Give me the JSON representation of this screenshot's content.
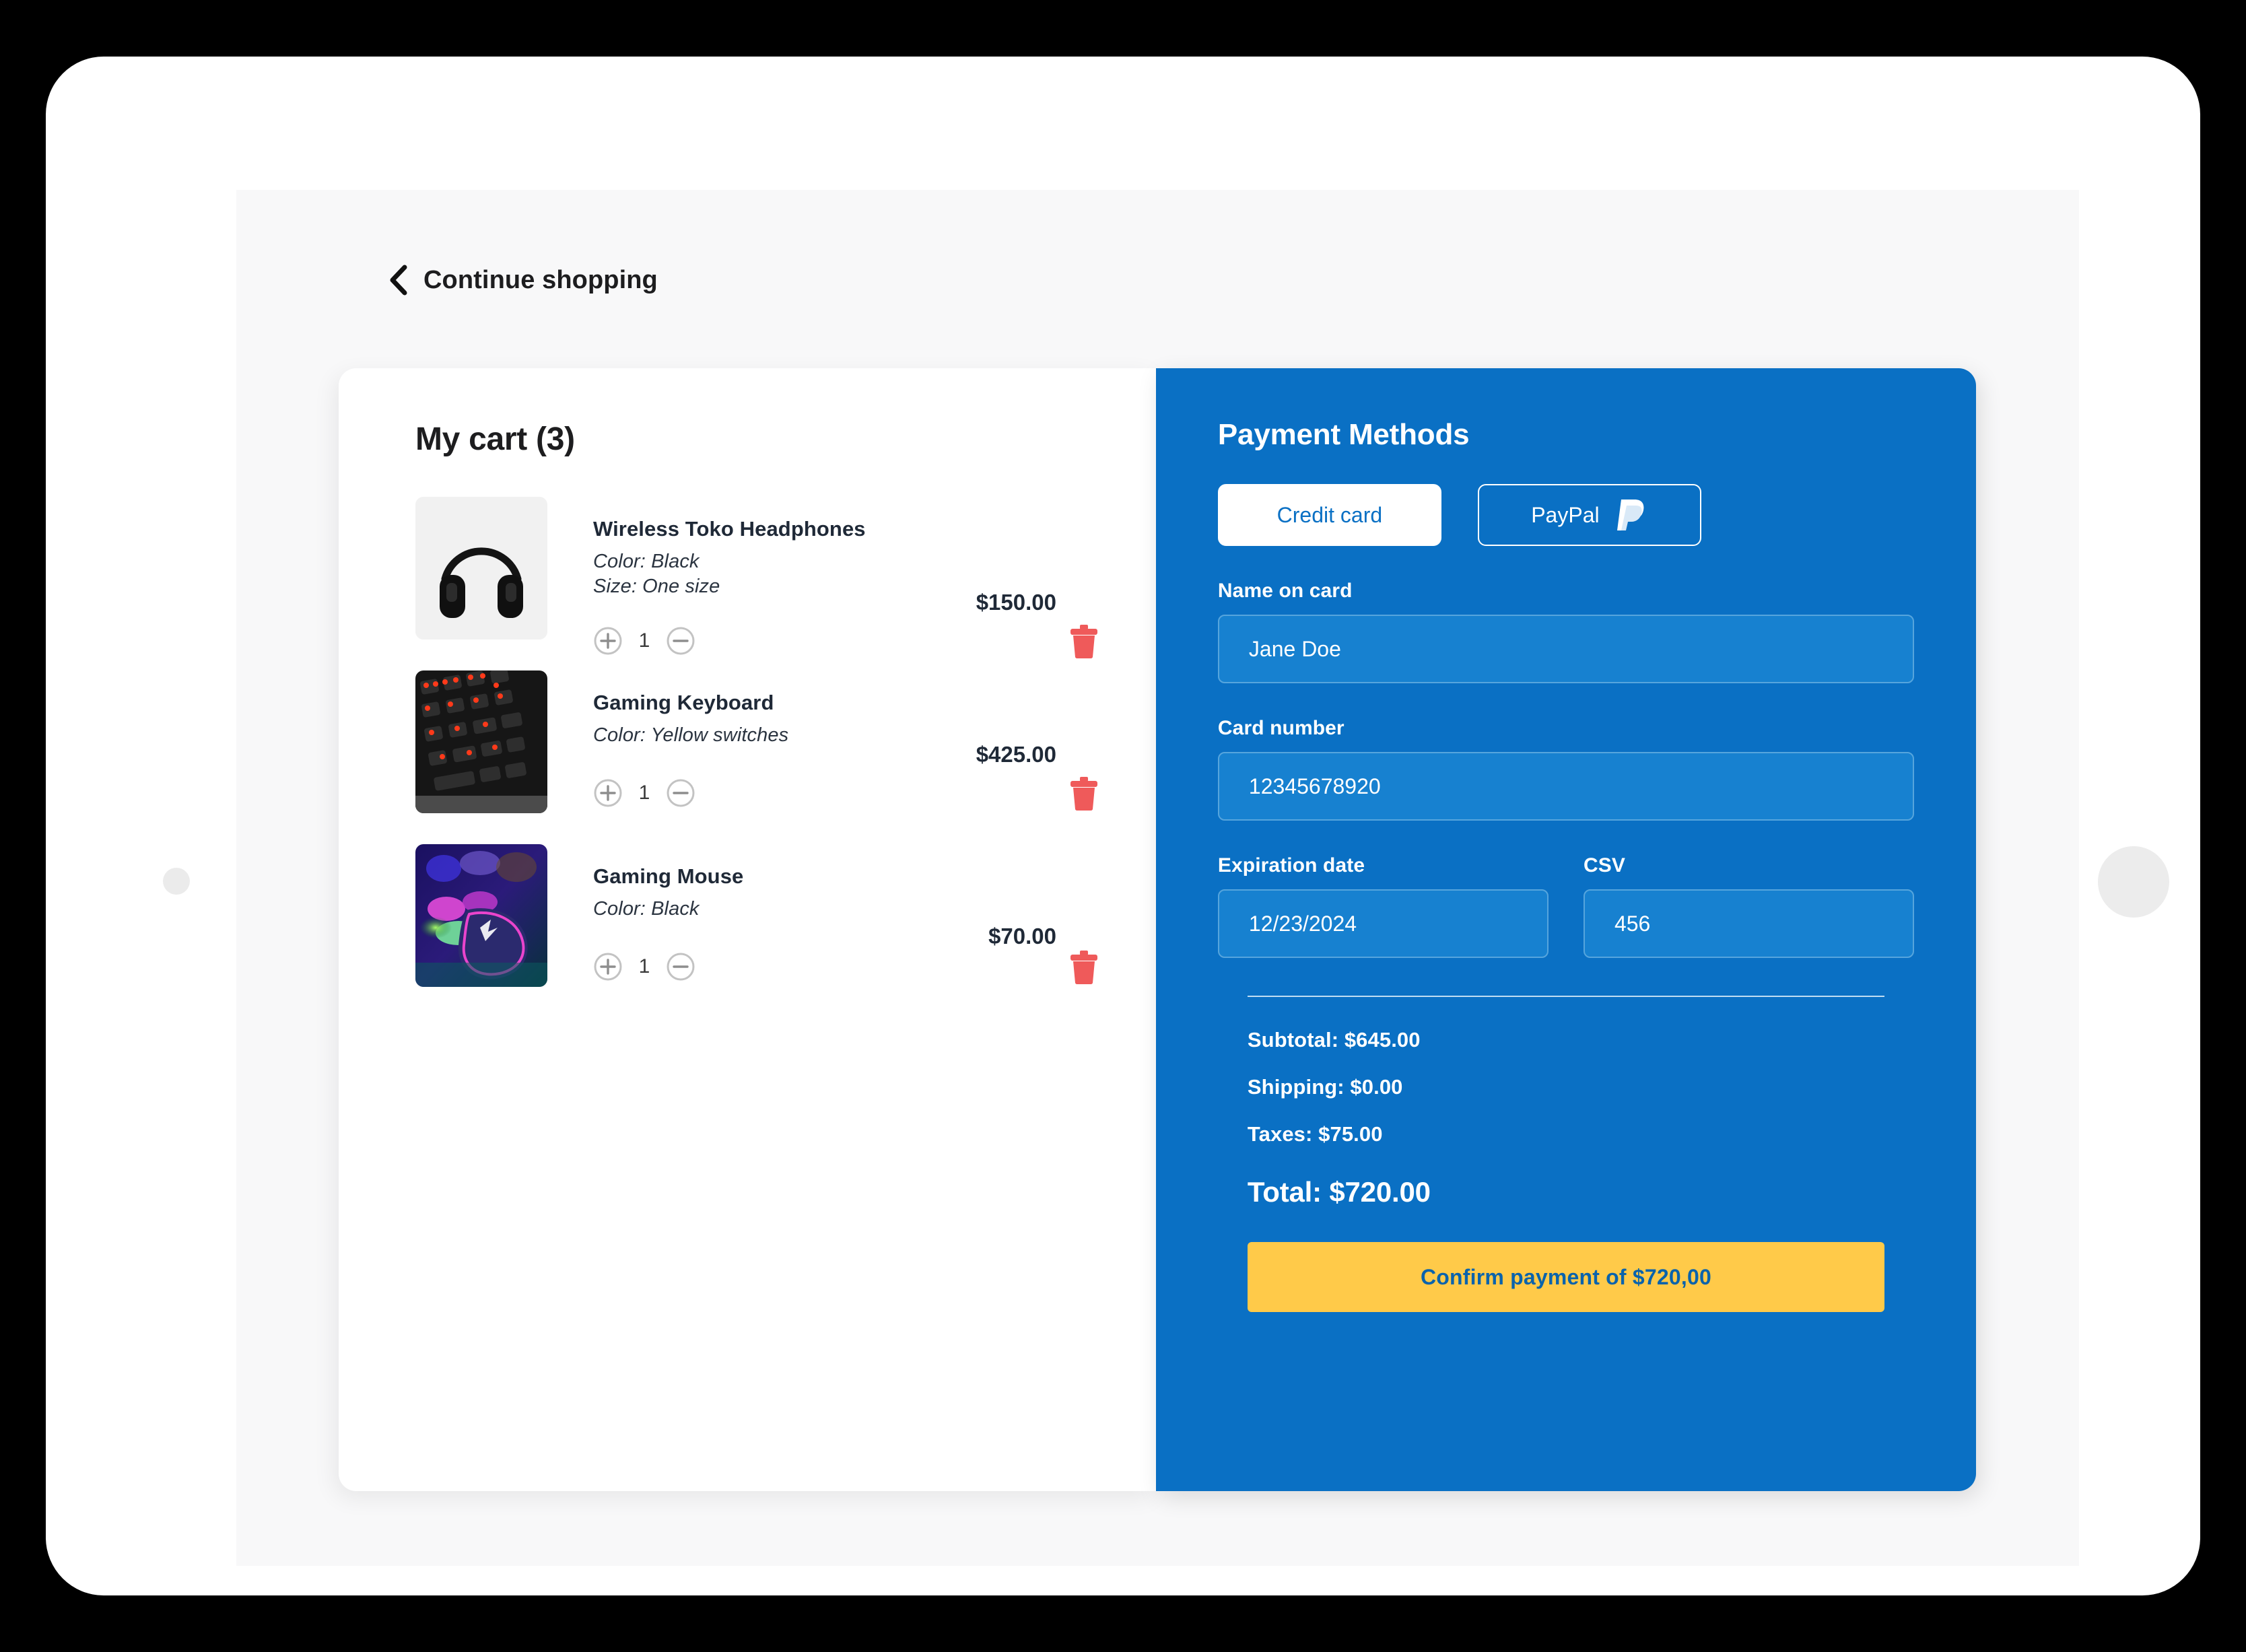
{
  "device": {
    "camera_icon": "camera-dot",
    "home_icon": "home-button"
  },
  "nav": {
    "back_icon": "chevron-left-icon",
    "continue_label": "Continue shopping"
  },
  "cart": {
    "title": "My cart (3)",
    "count": 3,
    "items": [
      {
        "image_icon": "headphones-image",
        "name": "Wireless Toko Headphones",
        "attr_color": "Color: Black",
        "attr_size": "Size: One size",
        "price": "$150.00",
        "quantity": "1",
        "increase_icon": "plus-circle-icon",
        "decrease_icon": "minus-circle-icon",
        "remove_icon": "trash-icon"
      },
      {
        "image_icon": "keyboard-image",
        "name": "Gaming Keyboard",
        "attr_color": "Color: Yellow switches",
        "attr_size": "",
        "price": "$425.00",
        "quantity": "1",
        "increase_icon": "plus-circle-icon",
        "decrease_icon": "minus-circle-icon",
        "remove_icon": "trash-icon"
      },
      {
        "image_icon": "mouse-image",
        "name": "Gaming Mouse",
        "attr_color": "Color: Black",
        "attr_size": "",
        "price": "$70.00",
        "quantity": "1",
        "increase_icon": "plus-circle-icon",
        "decrease_icon": "minus-circle-icon",
        "remove_icon": "trash-icon"
      }
    ]
  },
  "payment": {
    "title": "Payment Methods",
    "methods": [
      {
        "label": "Credit card",
        "selected": true,
        "icon": ""
      },
      {
        "label": "PayPal",
        "selected": false,
        "icon": "paypal-icon"
      }
    ],
    "fields": {
      "name_label": "Name on card",
      "name_value": "Jane Doe",
      "card_label": "Card number",
      "card_value": "12345678920",
      "exp_label": "Expiration date",
      "exp_value": "12/23/2024",
      "csv_label": "CSV",
      "csv_value": "456"
    },
    "summary": {
      "subtotal": "Subtotal: $645.00",
      "shipping": "Shipping: $0.00",
      "taxes": "Taxes: $75.00",
      "total": "Total: $720.00"
    },
    "confirm_label": "Confirm payment of $720,00"
  },
  "colors": {
    "panel_blue": "#0a70c4",
    "input_blue": "#1781d0",
    "input_border": "#56a5dd",
    "confirm_yellow": "#ffca49",
    "confirm_text": "#0a63ac",
    "trash_red": "#ef5a5a",
    "screen_bg": "#f8f8f9",
    "card_white": "#ffffff"
  }
}
